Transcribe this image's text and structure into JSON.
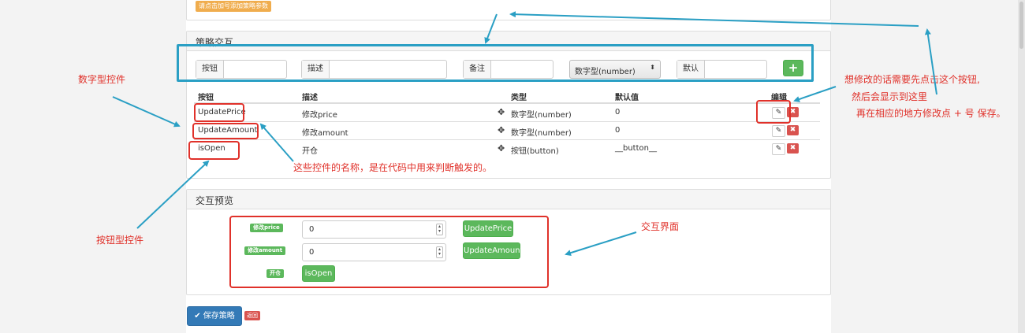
{
  "top_panel": {
    "tag_label": "请点击加号添加策略参数"
  },
  "strategy_interaction": {
    "title": "策略交互",
    "add_form": {
      "button_addon": "按钮",
      "desc_addon": "描述",
      "note_addon": "备注",
      "type_select": "数字型(number)",
      "default_addon": "默认",
      "add_button": "+"
    },
    "table": {
      "headers": [
        "按钮",
        "描述",
        "类型",
        "默认值",
        "编辑"
      ],
      "rows": [
        {
          "button": "UpdatePrice",
          "desc": "修改price",
          "type": "数字型(number)",
          "default": "0"
        },
        {
          "button": "UpdateAmount",
          "desc": "修改amount",
          "type": "数字型(number)",
          "default": "0"
        },
        {
          "button": "isOpen",
          "desc": "开仓",
          "type": "按钮(button)",
          "default": "__button__"
        }
      ]
    }
  },
  "preview": {
    "title": "交互预览",
    "rows": [
      {
        "label": "修改price",
        "value": "0",
        "button": "UpdatePrice"
      },
      {
        "label": "修改amount",
        "value": "0",
        "button": "UpdateAmount"
      },
      {
        "label": "开仓",
        "button": "isOpen"
      }
    ]
  },
  "footer": {
    "save_button": "✔ 保存策略",
    "back_button": "返回"
  },
  "annotations": {
    "numeric_control": "数字型控件",
    "button_control": "按钮型控件",
    "control_names": "这些控件的名称，是在代码中用来判断触发的。",
    "interface": "交互界面",
    "edit_note_1": "想修改的话需要先点击这个按钮,",
    "edit_note_2": "然后会显示到这里",
    "edit_note_3": "再在相应的地方修改点 + 号 保存。"
  },
  "colors": {
    "annotation_red": "#e0312a",
    "annotation_blue": "#2a9fc4",
    "success_green": "#5cb85c",
    "danger_red": "#d9534f",
    "primary_blue": "#337ab7",
    "warning_orange": "#f0ad4e"
  }
}
